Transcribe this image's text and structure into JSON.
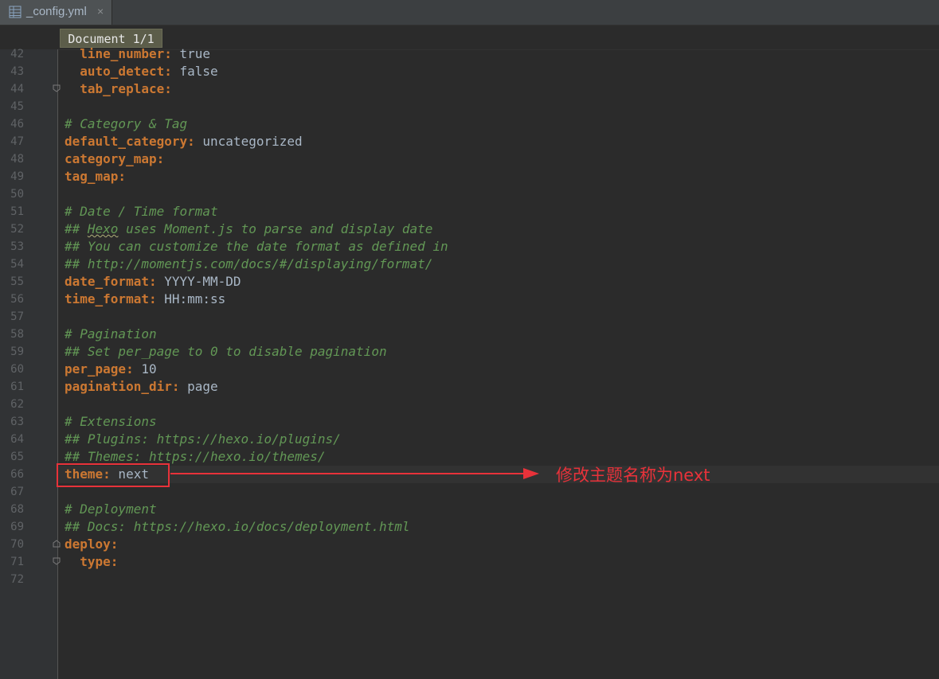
{
  "tab": {
    "file_name": "_config.yml",
    "close_symbol": "×"
  },
  "breadcrumb": {
    "document_label": "Document 1/1"
  },
  "lines": [
    {
      "num": "42",
      "segments": [
        {
          "t": "  ",
          "c": "val"
        },
        {
          "t": "line_number:",
          "c": "key"
        },
        {
          "t": " true",
          "c": "val"
        }
      ]
    },
    {
      "num": "43",
      "segments": [
        {
          "t": "  ",
          "c": "val"
        },
        {
          "t": "auto_detect:",
          "c": "key"
        },
        {
          "t": " false",
          "c": "val"
        }
      ]
    },
    {
      "num": "44",
      "segments": [
        {
          "t": "  ",
          "c": "val"
        },
        {
          "t": "tab_replace:",
          "c": "key"
        }
      ]
    },
    {
      "num": "45",
      "segments": []
    },
    {
      "num": "46",
      "segments": [
        {
          "t": "# Category & Tag",
          "c": "comment"
        }
      ]
    },
    {
      "num": "47",
      "segments": [
        {
          "t": "default_category:",
          "c": "key"
        },
        {
          "t": " uncategorized",
          "c": "val"
        }
      ]
    },
    {
      "num": "48",
      "segments": [
        {
          "t": "category_map:",
          "c": "key"
        }
      ]
    },
    {
      "num": "49",
      "segments": [
        {
          "t": "tag_map:",
          "c": "key"
        }
      ]
    },
    {
      "num": "50",
      "segments": []
    },
    {
      "num": "51",
      "segments": [
        {
          "t": "# Date / Time format",
          "c": "comment"
        }
      ]
    },
    {
      "num": "52",
      "segments": [
        {
          "t": "## ",
          "c": "comment"
        },
        {
          "t": "Hexo",
          "c": "comment squiggle"
        },
        {
          "t": " uses Moment.js to parse and display date",
          "c": "comment"
        }
      ]
    },
    {
      "num": "53",
      "segments": [
        {
          "t": "## You can customize the date format as defined in",
          "c": "comment"
        }
      ]
    },
    {
      "num": "54",
      "segments": [
        {
          "t": "## http://momentjs.com/docs/#/displaying/format/",
          "c": "comment"
        }
      ]
    },
    {
      "num": "55",
      "segments": [
        {
          "t": "date_format:",
          "c": "key"
        },
        {
          "t": " YYYY-MM-DD",
          "c": "val"
        }
      ]
    },
    {
      "num": "56",
      "segments": [
        {
          "t": "time_format:",
          "c": "key"
        },
        {
          "t": " HH:mm:ss",
          "c": "val"
        }
      ]
    },
    {
      "num": "57",
      "segments": []
    },
    {
      "num": "58",
      "segments": [
        {
          "t": "# Pagination",
          "c": "comment"
        }
      ]
    },
    {
      "num": "59",
      "segments": [
        {
          "t": "## Set per_page to 0 to disable pagination",
          "c": "comment"
        }
      ]
    },
    {
      "num": "60",
      "segments": [
        {
          "t": "per_page:",
          "c": "key"
        },
        {
          "t": " 10",
          "c": "val"
        }
      ]
    },
    {
      "num": "61",
      "segments": [
        {
          "t": "pagination_dir:",
          "c": "key"
        },
        {
          "t": " page",
          "c": "val"
        }
      ]
    },
    {
      "num": "62",
      "segments": []
    },
    {
      "num": "63",
      "segments": [
        {
          "t": "# Extensions",
          "c": "comment"
        }
      ]
    },
    {
      "num": "64",
      "segments": [
        {
          "t": "## Plugins: https://hexo.io/plugins/",
          "c": "comment"
        }
      ]
    },
    {
      "num": "65",
      "segments": [
        {
          "t": "## Themes: https://hexo.io/themes/",
          "c": "comment"
        }
      ]
    },
    {
      "num": "66",
      "segments": [
        {
          "t": "theme:",
          "c": "key"
        },
        {
          "t": " next",
          "c": "val"
        }
      ]
    },
    {
      "num": "67",
      "segments": []
    },
    {
      "num": "68",
      "segments": [
        {
          "t": "# Deployment",
          "c": "comment"
        }
      ]
    },
    {
      "num": "69",
      "segments": [
        {
          "t": "## Docs: https://hexo.io/docs/deployment.html",
          "c": "comment"
        }
      ]
    },
    {
      "num": "70",
      "segments": [
        {
          "t": "deploy:",
          "c": "key"
        }
      ]
    },
    {
      "num": "71",
      "segments": [
        {
          "t": "  ",
          "c": "val"
        },
        {
          "t": "type:",
          "c": "key"
        }
      ]
    },
    {
      "num": "72",
      "segments": []
    }
  ],
  "annotation": {
    "text": "修改主题名称为next",
    "color": "#e8323a"
  },
  "colors": {
    "key": "#cc7832",
    "comment": "#629755",
    "value": "#a9b7c6",
    "background": "#2b2b2b"
  }
}
